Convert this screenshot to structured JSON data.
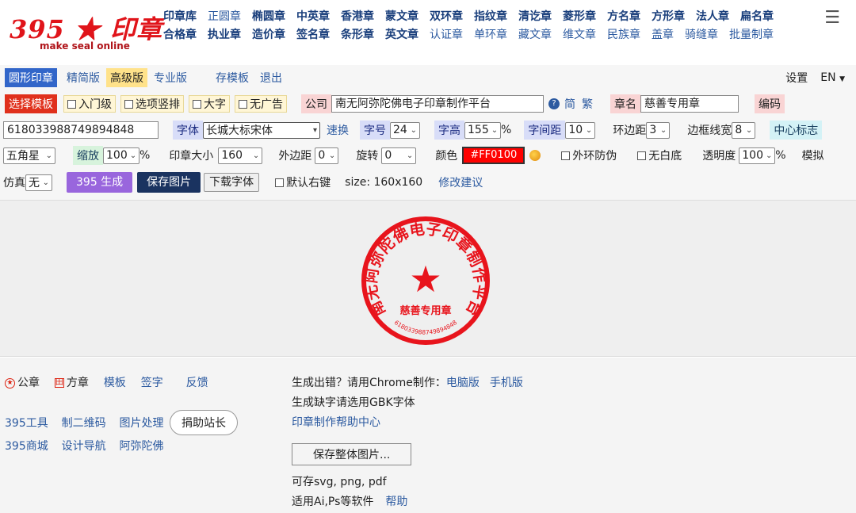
{
  "header": {
    "logo_main": "395 ★ 印章",
    "logo_sub": "make seal online",
    "nav_row1": [
      "印章库",
      "正圆章",
      "椭圆章",
      "中英章",
      "香港章",
      "蒙文章",
      "双环章",
      "指纹章",
      "清讫章",
      "菱形章",
      "方名章",
      "方形章",
      "法人章",
      "扁名章"
    ],
    "nav_row2": [
      "合格章",
      "执业章",
      "造价章",
      "签名章",
      "条形章",
      "英文章",
      "认证章",
      "单环章",
      "藏文章",
      "维文章",
      "民族章",
      "盖章",
      "骑缝章",
      "批量制章"
    ]
  },
  "row1": {
    "mode_round": "圆形印章",
    "mode_simple": "精简版",
    "mode_advanced": "高级版",
    "mode_pro": "专业版",
    "save_template": "存模板",
    "exit": "退出",
    "settings": "设置",
    "lang": "EN"
  },
  "row2": {
    "choose_template": "选择模板",
    "chk_beginner": "入门级",
    "chk_vertical": "选项竖排",
    "chk_big": "大字",
    "chk_noad": "无广告",
    "company_label": "公司",
    "company_value": "南无阿弥陀佛电子印章制作平台",
    "simplified": "简",
    "traditional": "繁",
    "seal_name_label": "章名",
    "seal_name_value": "慈善专用章",
    "encode": "编码"
  },
  "row3": {
    "code_value": "618033988749894848",
    "font_label": "字体",
    "font_value": "长城大标宋体",
    "quick_switch": "速换",
    "size_label": "字号",
    "size_value": "24",
    "height_label": "字高",
    "height_value": "155",
    "pct": "%",
    "spacing_label": "字间距",
    "spacing_value": "10",
    "ring_margin_label": "环边距",
    "ring_margin_value": "3",
    "border_width_label": "边框线宽",
    "border_width_value": "8",
    "center_logo": "中心标志"
  },
  "row4": {
    "star_value": "五角星",
    "zoom_label": "缩放",
    "zoom_value": "100",
    "pct": "%",
    "seal_size_label": "印章大小",
    "seal_size_value": "160",
    "outer_margin_label": "外边距",
    "outer_margin_value": "0",
    "rotate_label": "旋转",
    "rotate_value": "0",
    "color_label": "颜色",
    "color_value": "#FF0100",
    "chk_outer_ring": "外环防伪",
    "chk_no_white": "无白底",
    "opacity_label": "透明度",
    "opacity_value": "100",
    "simulate": "模拟"
  },
  "row5": {
    "fake_label": "仿真",
    "fake_value": "无",
    "generate": "395 生成",
    "save_image": "保存图片",
    "download_font": "下载字体",
    "chk_default_right": "默认右键",
    "size_info": "size: 160x160",
    "suggest": "修改建议"
  },
  "seal": {
    "company_text": "南无阿弥陀佛电子印章制作平台",
    "name_text": "慈善专用章",
    "code_text": "618033988749894848",
    "star": "★",
    "color": "#e8141c"
  },
  "footer": {
    "round_seal": "公章",
    "square_seal": "方章",
    "template": "模板",
    "signature": "签字",
    "feedback": "反馈",
    "tools": "395工具",
    "qrcode": "制二维码",
    "image_proc": "图片处理",
    "donate": "捐助站长",
    "mall": "395商城",
    "design_nav": "设计导航",
    "amitabha": "阿弥陀佛",
    "error_text": "生成出错？请用Chrome制作：",
    "pc_version": "电脑版",
    "mobile_version": "手机版",
    "gbk_text": "生成缺字请选用GBK字体",
    "help_center": "印章制作帮助中心",
    "save_whole": "保存整体图片...",
    "formats": "可存svg, png, pdf",
    "ai_ps": "适用Ai,Ps等软件",
    "help": "帮助"
  }
}
